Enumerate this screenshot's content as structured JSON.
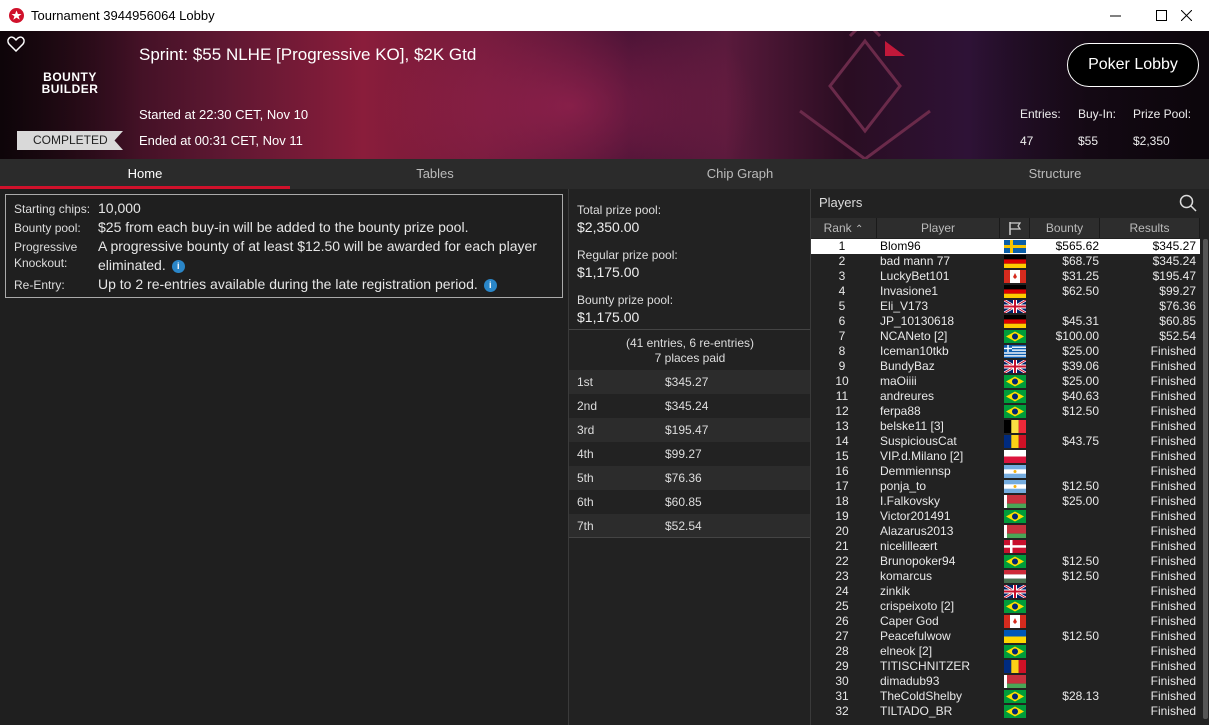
{
  "window": {
    "title": "Tournament 3944956064 Lobby"
  },
  "header": {
    "tournament_name": "Sprint: $55 NLHE [Progressive KO], $2K Gtd",
    "brand_top": "BOUNTY",
    "brand_bottom": "BUILDER",
    "started": "Started at 22:30 CET, Nov 10",
    "ended": "Ended at 00:31 CET, Nov 11",
    "status": "COMPLETED",
    "poker_lobby": "Poker Lobby",
    "entries_label": "Entries:",
    "entries_value": "47",
    "buyin_label": "Buy-In:",
    "buyin_value": "$55",
    "prizepool_label": "Prize Pool:",
    "prizepool_value": "$2,350"
  },
  "tabs": [
    {
      "label": "Home"
    },
    {
      "label": "Tables"
    },
    {
      "label": "Chip Graph"
    },
    {
      "label": "Structure"
    }
  ],
  "info": {
    "starting_chips_label": "Starting chips:",
    "starting_chips": "10,000",
    "bounty_pool_label": "Bounty pool:",
    "bounty_pool": "$25 from each buy-in will be added to the bounty prize pool.",
    "pko_label_1": "Progressive",
    "pko_label_2": "Knockout:",
    "pko": "A progressive bounty of at least $12.50 will be awarded for each player eliminated.",
    "reentry_label": "Re-Entry:",
    "reentry": "Up to 2 re-entries available during the late registration period."
  },
  "prizes": {
    "total_label": "Total prize pool:",
    "total": "$2,350.00",
    "regular_label": "Regular prize pool:",
    "regular": "$1,175.00",
    "bounty_label": "Bounty prize pool:",
    "bounty": "$1,175.00",
    "entries_line": "(41 entries, 6 re-entries)",
    "places_line": "7 places paid",
    "payouts": [
      {
        "place": "1st",
        "amount": "$345.27"
      },
      {
        "place": "2nd",
        "amount": "$345.24"
      },
      {
        "place": "3rd",
        "amount": "$195.47"
      },
      {
        "place": "4th",
        "amount": "$99.27"
      },
      {
        "place": "5th",
        "amount": "$76.36"
      },
      {
        "place": "6th",
        "amount": "$60.85"
      },
      {
        "place": "7th",
        "amount": "$52.54"
      }
    ]
  },
  "players": {
    "title": "Players",
    "columns": {
      "rank": "Rank",
      "player": "Player",
      "bounty": "Bounty",
      "results": "Results"
    },
    "rows": [
      {
        "rank": "1",
        "name": "Blom96",
        "flag": "SE",
        "bounty": "$565.62",
        "result": "$345.27"
      },
      {
        "rank": "2",
        "name": "bad mann 77",
        "flag": "DE",
        "bounty": "$68.75",
        "result": "$345.24"
      },
      {
        "rank": "3",
        "name": "LuckyBet101",
        "flag": "CA",
        "bounty": "$31.25",
        "result": "$195.47"
      },
      {
        "rank": "4",
        "name": "Invasione1",
        "flag": "DE",
        "bounty": "$62.50",
        "result": "$99.27"
      },
      {
        "rank": "5",
        "name": "Eli_V173",
        "flag": "GB",
        "bounty": "",
        "result": "$76.36"
      },
      {
        "rank": "6",
        "name": "JP_10130618",
        "flag": "DE",
        "bounty": "$45.31",
        "result": "$60.85"
      },
      {
        "rank": "7",
        "name": "NCANeto [2]",
        "flag": "BR",
        "bounty": "$100.00",
        "result": "$52.54"
      },
      {
        "rank": "8",
        "name": "Iceman10tkb",
        "flag": "GR",
        "bounty": "$25.00",
        "result": "Finished"
      },
      {
        "rank": "9",
        "name": "BundyBaz",
        "flag": "GB",
        "bounty": "$39.06",
        "result": "Finished"
      },
      {
        "rank": "10",
        "name": "maOiiii",
        "flag": "BR",
        "bounty": "$25.00",
        "result": "Finished"
      },
      {
        "rank": "11",
        "name": "andreures",
        "flag": "BR",
        "bounty": "$40.63",
        "result": "Finished"
      },
      {
        "rank": "12",
        "name": "ferpa88",
        "flag": "BR",
        "bounty": "$12.50",
        "result": "Finished"
      },
      {
        "rank": "13",
        "name": "belske11 [3]",
        "flag": "BE",
        "bounty": "",
        "result": "Finished"
      },
      {
        "rank": "14",
        "name": "SuspiciousCat",
        "flag": "RO",
        "bounty": "$43.75",
        "result": "Finished"
      },
      {
        "rank": "15",
        "name": "VIP.d.Milano [2]",
        "flag": "PL",
        "bounty": "",
        "result": "Finished"
      },
      {
        "rank": "16",
        "name": "Demmiennsp",
        "flag": "AR",
        "bounty": "",
        "result": "Finished"
      },
      {
        "rank": "17",
        "name": "ponja_to",
        "flag": "AR",
        "bounty": "$12.50",
        "result": "Finished"
      },
      {
        "rank": "18",
        "name": "I.Falkovsky",
        "flag": "BY",
        "bounty": "$25.00",
        "result": "Finished"
      },
      {
        "rank": "19",
        "name": "Victor201491",
        "flag": "BR",
        "bounty": "",
        "result": "Finished"
      },
      {
        "rank": "20",
        "name": "Alazarus2013",
        "flag": "BY",
        "bounty": "",
        "result": "Finished"
      },
      {
        "rank": "21",
        "name": "nicelilleært",
        "flag": "DK",
        "bounty": "",
        "result": "Finished"
      },
      {
        "rank": "22",
        "name": "Brunopoker94",
        "flag": "BR",
        "bounty": "$12.50",
        "result": "Finished"
      },
      {
        "rank": "23",
        "name": "komarcus",
        "flag": "HU",
        "bounty": "$12.50",
        "result": "Finished"
      },
      {
        "rank": "24",
        "name": "zinkik",
        "flag": "GB",
        "bounty": "",
        "result": "Finished"
      },
      {
        "rank": "25",
        "name": "crispeixoto [2]",
        "flag": "BR",
        "bounty": "",
        "result": "Finished"
      },
      {
        "rank": "26",
        "name": "Caper God",
        "flag": "CA",
        "bounty": "",
        "result": "Finished"
      },
      {
        "rank": "27",
        "name": "Peacefulwow",
        "flag": "UA",
        "bounty": "$12.50",
        "result": "Finished"
      },
      {
        "rank": "28",
        "name": "elneok [2]",
        "flag": "BR",
        "bounty": "",
        "result": "Finished"
      },
      {
        "rank": "29",
        "name": "TITISCHNITZER",
        "flag": "RO",
        "bounty": "",
        "result": "Finished"
      },
      {
        "rank": "30",
        "name": "dimadub93",
        "flag": "BY",
        "bounty": "",
        "result": "Finished"
      },
      {
        "rank": "31",
        "name": "TheColdShelby",
        "flag": "BR",
        "bounty": "$28.13",
        "result": "Finished"
      },
      {
        "rank": "32",
        "name": "TILTADO_BR",
        "flag": "BR",
        "bounty": "",
        "result": "Finished"
      }
    ]
  },
  "colors": {
    "accent": "#d0112b",
    "info": "#2a86c8",
    "bg": "#1f1f1f"
  }
}
